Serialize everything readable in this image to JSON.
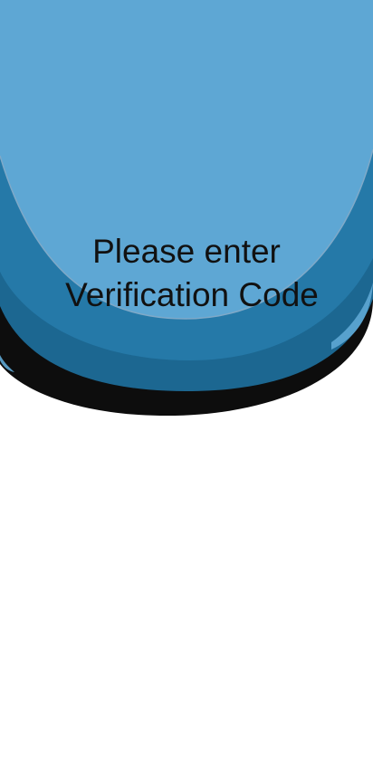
{
  "screen": {
    "title_line_1": "Please enter",
    "title_line_2": "Verification Code"
  },
  "colors": {
    "black_layer": "#0d0d0d",
    "dark_blue_layer": "#1c6791",
    "mid_blue_layer": "#2579a8",
    "light_blue_layer": "#5ea7d4",
    "highlight": "#7fa9c8",
    "title_text": "#111111",
    "background": "#ffffff"
  }
}
